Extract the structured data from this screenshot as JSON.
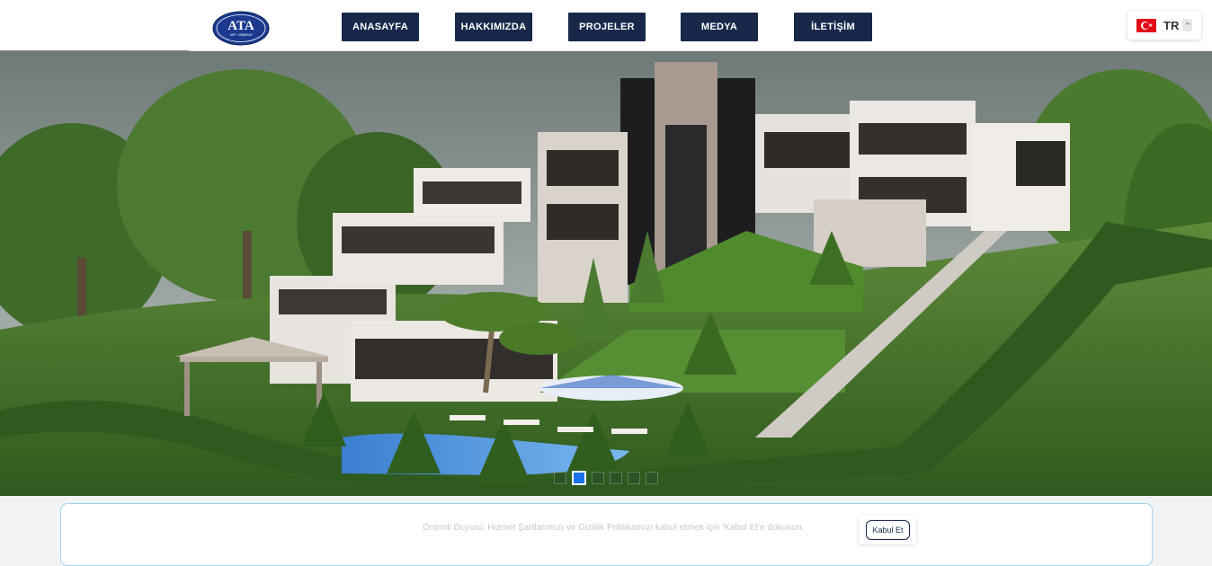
{
  "brand": {
    "logo_text": "ATA",
    "logo_subtext": "YAPI · MİMARLIK"
  },
  "nav": {
    "items": [
      {
        "label": "ANASAYFA"
      },
      {
        "label": "HAKKIMIZDA"
      },
      {
        "label": "PROJELER"
      },
      {
        "label": "MEDYA"
      },
      {
        "label": "İLETİŞİM"
      }
    ]
  },
  "language": {
    "code": "TR",
    "flag_icon": "turkey-flag-icon",
    "chevron_icon": "chevron-up-icon"
  },
  "slider": {
    "total_slides": 6,
    "active_index": 0
  },
  "cookie_notice": {
    "text": "Önemli Duyuru: Hizmet Şartlarımızı ve Gizlilik Politikamızı kabul etmek için 'Kabul Et'e dokunun.",
    "accept_label": "Kabul Et"
  },
  "colors": {
    "nav_bg": "#17284a",
    "accent": "#1a73e8",
    "notice_border": "#9fd4ec"
  }
}
